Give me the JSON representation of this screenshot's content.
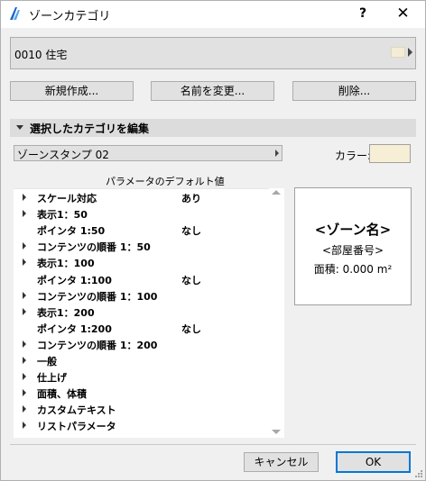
{
  "window": {
    "title": "ゾーンカテゴリ",
    "help_label": "?",
    "close_label": "✕"
  },
  "category": {
    "value": "0010  住宅",
    "swatch_color": "#f5ecd5"
  },
  "buttons": {
    "new": "新規作成...",
    "rename": "名前を変更...",
    "delete": "削除..."
  },
  "section": {
    "title": "選択したカテゴリを編集"
  },
  "stamp": {
    "value": "ゾーンスタンプ 02"
  },
  "color": {
    "label": "カラー:",
    "value": "#f6eed5"
  },
  "params": {
    "header": "パラメータのデフォルト値",
    "rows": [
      {
        "name": "スケール対応",
        "value": "あり",
        "expandable": true
      },
      {
        "name": "表示1：50",
        "value": "",
        "expandable": true
      },
      {
        "name": "ポインタ 1:50",
        "value": "なし",
        "expandable": false
      },
      {
        "name": "コンテンツの順番 1：50",
        "value": "",
        "expandable": true
      },
      {
        "name": "表示1：100",
        "value": "",
        "expandable": true
      },
      {
        "name": "ポインタ 1:100",
        "value": "なし",
        "expandable": false
      },
      {
        "name": "コンテンツの順番 1：100",
        "value": "",
        "expandable": true
      },
      {
        "name": "表示1：200",
        "value": "",
        "expandable": true
      },
      {
        "name": "ポインタ 1:200",
        "value": "なし",
        "expandable": false
      },
      {
        "name": "コンテンツの順番 1：200",
        "value": "",
        "expandable": true
      },
      {
        "name": "一般",
        "value": "",
        "expandable": true
      },
      {
        "name": "仕上げ",
        "value": "",
        "expandable": true
      },
      {
        "name": "面積、体積",
        "value": "",
        "expandable": true
      },
      {
        "name": "カスタムテキスト",
        "value": "",
        "expandable": true
      },
      {
        "name": "リストパラメータ",
        "value": "",
        "expandable": true
      }
    ]
  },
  "preview": {
    "zone_name": "<ゾーン名>",
    "room_number": "<部屋番号>",
    "area": "面積: 0.000 m²"
  },
  "footer": {
    "cancel": "キャンセル",
    "ok": "OK"
  }
}
